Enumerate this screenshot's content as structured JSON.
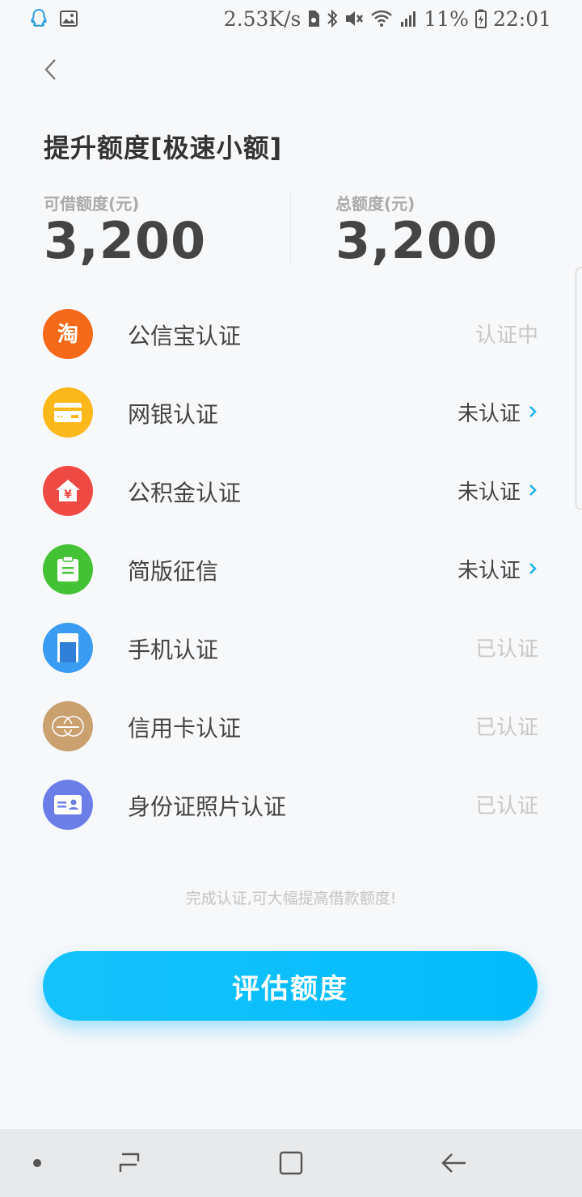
{
  "status_bar": {
    "net_speed": "2.53K/s",
    "battery": "11%",
    "time": "22:01"
  },
  "header": {
    "title": "提升额度[极速小额]"
  },
  "amounts": {
    "available_label": "可借额度(元)",
    "available_value": "3,200",
    "total_label": "总额度(元)",
    "total_value": "3,200"
  },
  "cert_items": [
    {
      "name": "公信宝认证",
      "status": "认证中",
      "icon": "taobao-icon",
      "color": "#f56a1a"
    },
    {
      "name": "网银认证",
      "status": "未认证",
      "icon": "bank-card-icon",
      "color": "#fbb81b"
    },
    {
      "name": "公积金认证",
      "status": "未认证",
      "icon": "housing-fund-icon",
      "color": "#ee4a43"
    },
    {
      "name": "简版征信",
      "status": "未认证",
      "icon": "clipboard-icon",
      "color": "#44c235"
    },
    {
      "name": "手机认证",
      "status": "已认证",
      "icon": "phone-icon",
      "color": "#3a9bf2"
    },
    {
      "name": "信用卡认证",
      "status": "已认证",
      "icon": "mastercard-icon",
      "color": "#c9a06e"
    },
    {
      "name": "身份证照片认证",
      "status": "已认证",
      "icon": "id-card-icon",
      "color": "#6b7ee8"
    }
  ],
  "hint": "完成认证,可大幅提高借款额度!",
  "button": {
    "label": "评估额度",
    "color": "#0bbffc"
  }
}
